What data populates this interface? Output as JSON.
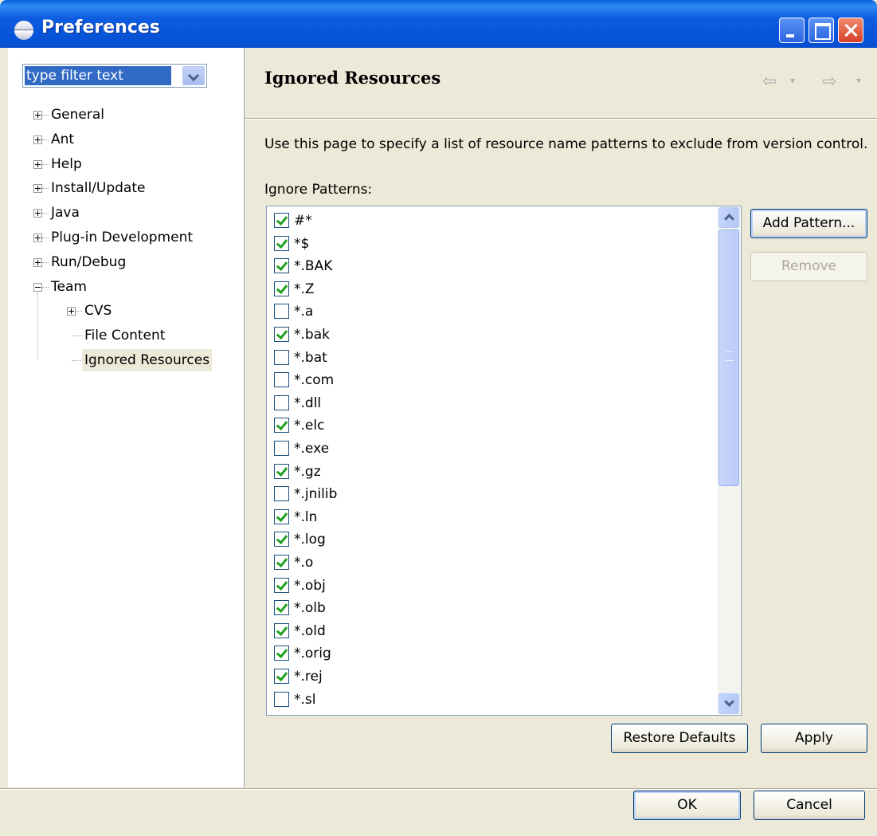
{
  "window": {
    "title": "Preferences"
  },
  "filter": {
    "value": "type filter text"
  },
  "tree": [
    {
      "label": "General",
      "expander": "plus"
    },
    {
      "label": "Ant",
      "expander": "plus"
    },
    {
      "label": "Help",
      "expander": "plus"
    },
    {
      "label": "Install/Update",
      "expander": "plus"
    },
    {
      "label": "Java",
      "expander": "plus"
    },
    {
      "label": "Plug-in Development",
      "expander": "plus"
    },
    {
      "label": "Run/Debug",
      "expander": "plus"
    },
    {
      "label": "Team",
      "expander": "minus"
    },
    {
      "label": "CVS",
      "expander": "plus"
    },
    {
      "label": "File Content",
      "expander": "none"
    },
    {
      "label": "Ignored Resources",
      "expander": "none",
      "selected": true
    }
  ],
  "page": {
    "title": "Ignored Resources",
    "description": "Use this page to specify a list of resource name patterns to exclude from version control.",
    "patterns_label": "Ignore Patterns:"
  },
  "patterns": [
    {
      "text": "#*",
      "checked": true
    },
    {
      "text": "*$",
      "checked": true
    },
    {
      "text": "*.BAK",
      "checked": true
    },
    {
      "text": "*.Z",
      "checked": true
    },
    {
      "text": "*.a",
      "checked": false
    },
    {
      "text": "*.bak",
      "checked": true
    },
    {
      "text": "*.bat",
      "checked": false
    },
    {
      "text": "*.com",
      "checked": false
    },
    {
      "text": "*.dll",
      "checked": false
    },
    {
      "text": "*.elc",
      "checked": true
    },
    {
      "text": "*.exe",
      "checked": false
    },
    {
      "text": "*.gz",
      "checked": true
    },
    {
      "text": "*.jnilib",
      "checked": false
    },
    {
      "text": "*.ln",
      "checked": true
    },
    {
      "text": "*.log",
      "checked": true
    },
    {
      "text": "*.o",
      "checked": true
    },
    {
      "text": "*.obj",
      "checked": true
    },
    {
      "text": "*.olb",
      "checked": true
    },
    {
      "text": "*.old",
      "checked": true
    },
    {
      "text": "*.orig",
      "checked": true
    },
    {
      "text": "*.rej",
      "checked": true
    },
    {
      "text": "*.sl",
      "checked": false
    }
  ],
  "buttons": {
    "add_pattern": "Add Pattern...",
    "remove": "Remove",
    "restore_defaults": "Restore Defaults",
    "apply": "Apply",
    "ok": "OK",
    "cancel": "Cancel"
  },
  "colors": {
    "titlebar": "#0651d6",
    "selection": "#316ac5",
    "check": "#21a121",
    "dialog_bg": "#ece9d8"
  }
}
